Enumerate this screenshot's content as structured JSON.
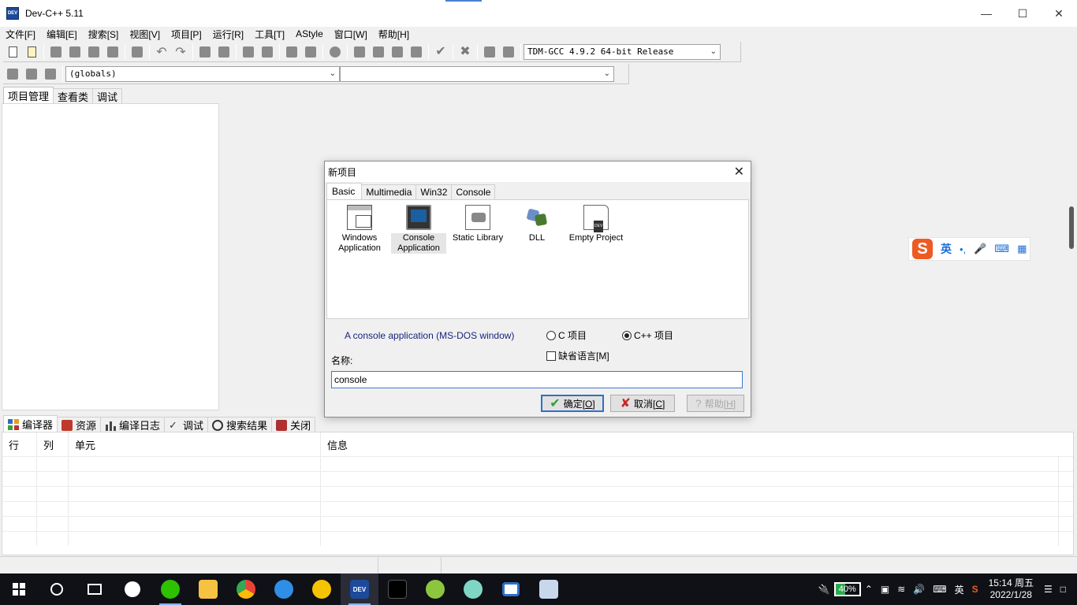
{
  "window": {
    "title": "Dev-C++ 5.11",
    "app_icon_text": "DEV"
  },
  "menu": [
    "文件[F]",
    "编辑[E]",
    "搜索[S]",
    "视图[V]",
    "项目[P]",
    "运行[R]",
    "工具[T]",
    "AStyle",
    "窗口[W]",
    "帮助[H]"
  ],
  "toolbar": {
    "compiler": "TDM-GCC 4.9.2 64-bit Release",
    "scope": "(globals)",
    "function": ""
  },
  "left_tabs": [
    "项目管理",
    "查看类",
    "调试"
  ],
  "bottom_tabs": [
    "编译器",
    "资源",
    "编译日志",
    "调试",
    "搜索结果",
    "关闭"
  ],
  "messages_table": {
    "columns": [
      "行",
      "列",
      "单元",
      "信息"
    ]
  },
  "ime": {
    "mode": "英",
    "punct": "•,",
    "logo": "S"
  },
  "dialog": {
    "title": "新项目",
    "tabs": [
      "Basic",
      "Multimedia",
      "Win32",
      "Console"
    ],
    "projects": [
      {
        "label_line1": "Windows",
        "label_line2": "Application"
      },
      {
        "label_line1": "Console",
        "label_line2": "Application"
      },
      {
        "label_line1": "Static Library",
        "label_line2": ""
      },
      {
        "label_line1": "DLL",
        "label_line2": ""
      },
      {
        "label_line1": "Empty Project",
        "label_line2": ""
      }
    ],
    "description": "A console application (MS-DOS window)",
    "radio_c": "C 项目",
    "radio_cpp": "C++ 项目",
    "default_lang": "缺省语言[M]",
    "name_label": "名称:",
    "name_value": "console",
    "ok": {
      "text": "确定[",
      "key": "O",
      "end": "]"
    },
    "cancel": {
      "text": "取消[",
      "key": "C",
      "end": "]"
    },
    "help": {
      "text": "帮助[",
      "key": "H",
      "end": "]"
    }
  },
  "taskbar": {
    "battery": "40%",
    "ime": "英",
    "time": "15:14 周五",
    "date": "2022/1/28",
    "dev_icon_text": "DEV"
  },
  "colors": {
    "accent": "#2f6fc7",
    "taskbar": "#0f1117",
    "ime_blue": "#1e6fd9",
    "sogou": "#ee5a24"
  }
}
